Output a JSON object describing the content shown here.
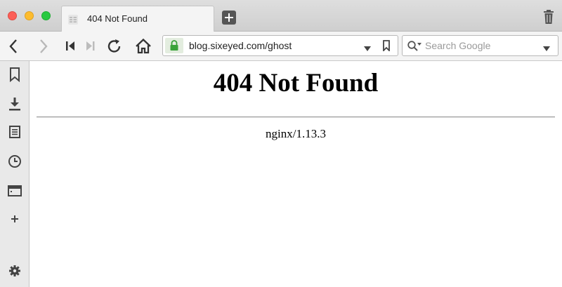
{
  "tab": {
    "title": "404 Not Found",
    "favicon": "page-icon"
  },
  "toolbar": {
    "url": "blog.sixeyed.com/ghost",
    "search_placeholder": "Search Google",
    "search_engine_icon": "search-icon"
  },
  "sidebar": {
    "items": [
      "bookmarks-icon",
      "downloads-icon",
      "notes-icon",
      "history-icon",
      "window-icon",
      "add-panel-icon",
      "settings-icon"
    ]
  },
  "page": {
    "heading": "404 Not Found",
    "server": "nginx/1.13.3"
  },
  "colors": {
    "lock_green": "#3ba23a",
    "tab_bar": "#d6d6d6",
    "toolbar": "#f4f4f4",
    "sidebar": "#e9e9e9"
  }
}
